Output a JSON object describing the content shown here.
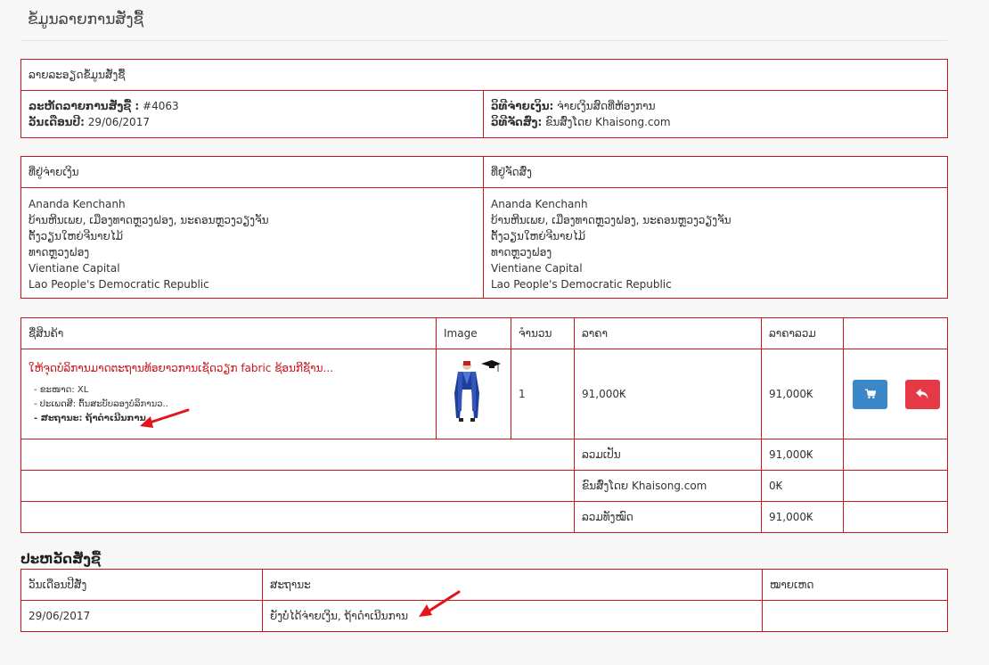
{
  "page": {
    "title": "ຂໍ້ມູນລາຍການສັ່ງຊື້"
  },
  "order_details": {
    "header": "ລາຍລະອຽດຂໍ້ມູນສັ່ງຊື້",
    "order_id_label": "ລະຫັດລາຍການສັ່ງຊື້ :",
    "order_id_value": "#4063",
    "date_label": "ວັນເດືອນປີ:",
    "date_value": "29/06/2017",
    "payment_label": "ວິທີຈ່າຍເງິນ:",
    "payment_value": "ຈ່າຍເງິນສົດທີ່ຫ້ອງການ",
    "shipping_label": "ວິທີຈັດສົ່ງ:",
    "shipping_value": "ຂົນສົ່ງໂດຍ Khaisong.com"
  },
  "addresses": {
    "payment_header": "ທີ່ຢູ່ຈ່າຍເງິນ",
    "shipping_header": "ທີ່ຢູ່ຈັດສົ່ງ",
    "payment_lines": [
      "Ananda Kenchanh",
      "ບ້ານຫີນເພຍ, ເມືອງທາດຫຼວງຝອງ, ນະຄອນຫຼວງວຽງຈັນ",
      "ຕັ້ງວຽນໃຫຍ່ຈີນາຍໄມ້",
      "ທາດຫຼວງຝອງ",
      "Vientiane Capital",
      "Lao People's Democratic Republic"
    ],
    "shipping_lines": [
      "Ananda Kenchanh",
      "ບ້ານຫີນເພຍ, ເມືອງທາດຫຼວງຝອງ, ນະຄອນຫຼວງວຽງຈັນ",
      "ຕັ້ງວຽນໃຫຍ່ຈີນາຍໄມ້",
      "ທາດຫຼວງຝອງ",
      "Vientiane Capital",
      "Lao People's Democratic Republic"
    ]
  },
  "products": {
    "headers": {
      "name": "ຊື່ສິນຄ້າ",
      "image": "Image",
      "quantity": "ຈຳນວນ",
      "price": "ລາຄາ",
      "total": "ລາຄາລວມ"
    },
    "item": {
      "name": "ໃຫ້ຈຸດບໍລິການມາດຕະຖານທ້ອຍາວການເຊັດວຽກ fabric ຊ້ອນກີຊັານ...",
      "options": [
        "- ຂະໜາດ: XL",
        "- ປະເພດສີ: ຕົ້ນສະບັບລອງບໍລິການວ..",
        "- ສະຖານະ: ຖ້າດຳເນີນການ"
      ],
      "quantity": "1",
      "price": "91,000₭",
      "total": "91,000₭"
    },
    "totals": [
      {
        "label": "ລວມເປັນ",
        "value": "91,000₭"
      },
      {
        "label": "ຂົນສົ່ງໂດຍ Khaisong.com",
        "value": "0₭"
      },
      {
        "label": "ລວມທັງໝົດ",
        "value": "91,000₭"
      }
    ]
  },
  "history": {
    "title": "ປະຫວັດສັ່ງຊື້",
    "headers": {
      "date": "ວັນເດືອນປີສັ່ງ",
      "status": "ສະຖານະ",
      "note": "ໝາຍເຫດ"
    },
    "rows": [
      {
        "date": "29/06/2017",
        "status": "ຍັງບໍ່ໄດ້ຈ່າຍເງິນ, ຖ້າດຳເນີນການ",
        "note": ""
      }
    ]
  },
  "colors": {
    "border": "#c8161d",
    "product_link": "#c8161d",
    "cart_button": "#3a88c8",
    "return_button": "#e53945",
    "annotation_arrow": "#e2151b"
  },
  "icons": {
    "cart_button": "shopping-cart-icon",
    "return_button": "reply-arrow-icon"
  }
}
